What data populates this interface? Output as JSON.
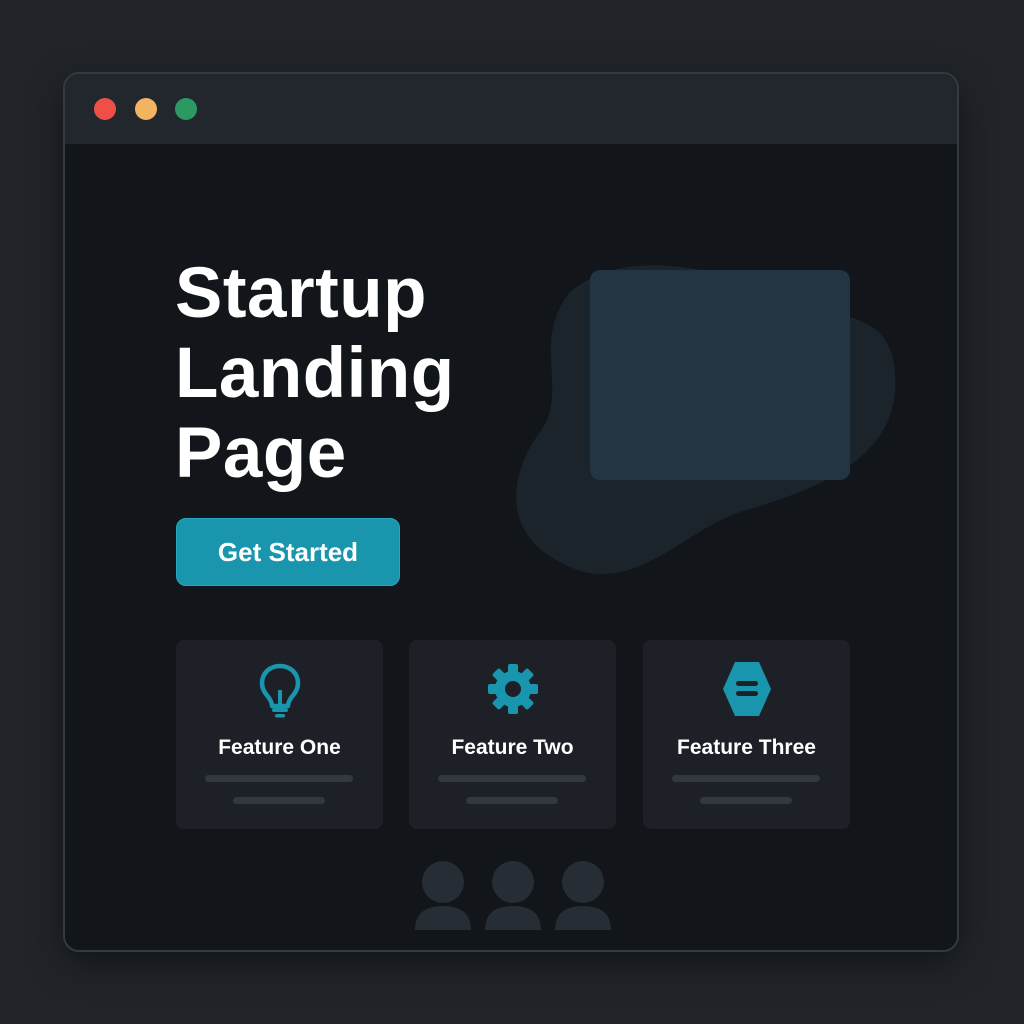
{
  "window": {
    "controls": [
      "close",
      "minimize",
      "maximize"
    ]
  },
  "hero": {
    "title_lines": [
      "Startup",
      "Landing",
      "Page"
    ],
    "cta_label": "Get Started"
  },
  "features": [
    {
      "icon": "lightbulb-icon",
      "title": "Feature One"
    },
    {
      "icon": "gear-icon",
      "title": "Feature Two"
    },
    {
      "icon": "hexagon-menu-icon",
      "title": "Feature Three"
    }
  ],
  "colors": {
    "accent": "#1996ad",
    "background": "#121519",
    "card": "#1d2127",
    "titlebar": "#22272e"
  }
}
